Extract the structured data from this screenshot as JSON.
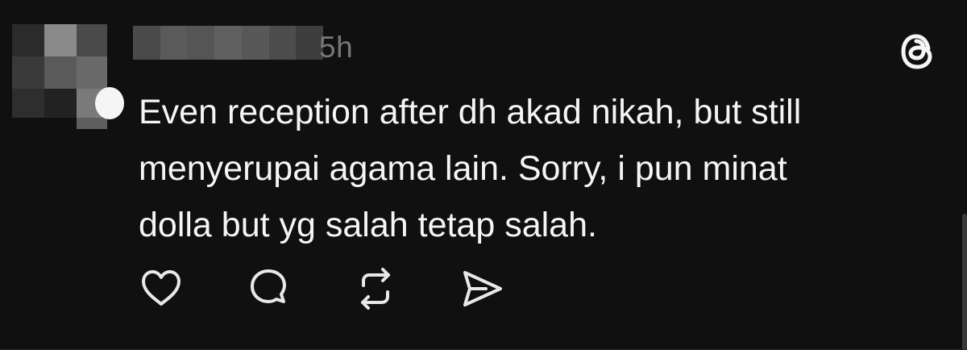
{
  "post": {
    "timestamp": "5h",
    "text_lines": [
      "Even reception after dh akad nikah, but still",
      "menyerupai agama lain. Sorry, i pun minat",
      "dolla but yg salah tetap salah."
    ],
    "author_blurred": true
  },
  "icons": {
    "logo": "threads-logo-icon",
    "like": "heart-icon",
    "reply": "comment-bubble-icon",
    "repost": "repost-icon",
    "share": "send-icon"
  },
  "colors": {
    "background": "#101010",
    "text": "#f3f5f7",
    "muted": "#777777",
    "icon": "#e8e8e8"
  }
}
